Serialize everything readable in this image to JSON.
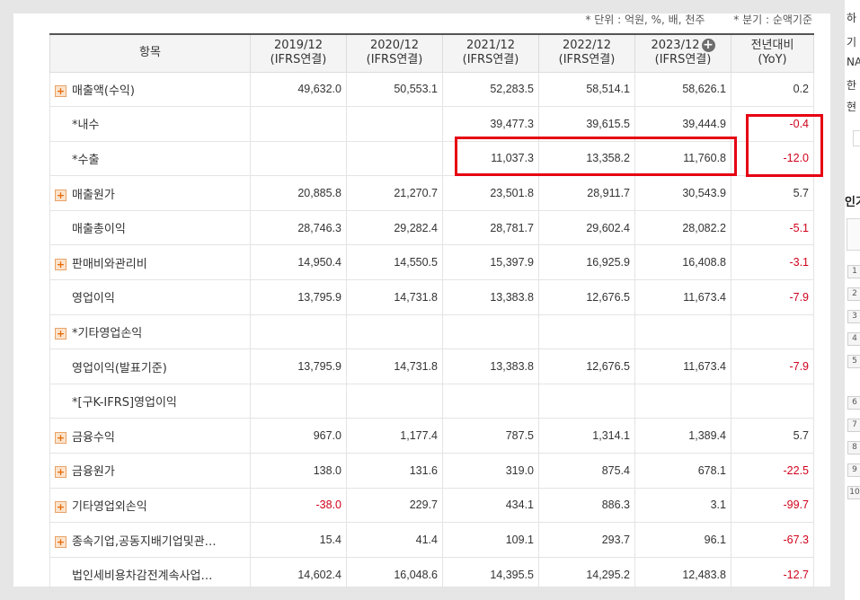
{
  "units": {
    "left": "* 단위 : 억원, %, 배, 천주",
    "right": "* 분기 : 순액기준"
  },
  "header": {
    "item": "항목",
    "cols": [
      {
        "year": "2019/12",
        "basis": "(IFRS연결)"
      },
      {
        "year": "2020/12",
        "basis": "(IFRS연결)"
      },
      {
        "year": "2021/12",
        "basis": "(IFRS연결)"
      },
      {
        "year": "2022/12",
        "basis": "(IFRS연결)"
      },
      {
        "year": "2023/12",
        "basis": "(IFRS연결)"
      }
    ],
    "yoy1": "전년대비",
    "yoy2": "(YoY)",
    "add_icon": "plus-circle-icon"
  },
  "rows": [
    {
      "label": "매출액(수익)",
      "expand": true,
      "values": [
        "49,632.0",
        "50,553.1",
        "52,283.5",
        "58,514.1",
        "58,626.1"
      ],
      "yoy": "0.2",
      "neg_yoy": false
    },
    {
      "label": "*내수",
      "expand": false,
      "values": [
        "",
        "",
        "39,477.3",
        "39,615.5",
        "39,444.9"
      ],
      "yoy": "-0.4",
      "neg_yoy": true
    },
    {
      "label": "*수출",
      "expand": false,
      "values": [
        "",
        "",
        "11,037.3",
        "13,358.2",
        "11,760.8"
      ],
      "yoy": "-12.0",
      "neg_yoy": true
    },
    {
      "label": "매출원가",
      "expand": true,
      "values": [
        "20,885.8",
        "21,270.7",
        "23,501.8",
        "28,911.7",
        "30,543.9"
      ],
      "yoy": "5.7",
      "neg_yoy": false
    },
    {
      "label": "매출총이익",
      "expand": false,
      "values": [
        "28,746.3",
        "29,282.4",
        "28,781.7",
        "29,602.4",
        "28,082.2"
      ],
      "yoy": "-5.1",
      "neg_yoy": true
    },
    {
      "label": "판매비와관리비",
      "expand": true,
      "values": [
        "14,950.4",
        "14,550.5",
        "15,397.9",
        "16,925.9",
        "16,408.8"
      ],
      "yoy": "-3.1",
      "neg_yoy": true
    },
    {
      "label": "영업이익",
      "expand": false,
      "values": [
        "13,795.9",
        "14,731.8",
        "13,383.8",
        "12,676.5",
        "11,673.4"
      ],
      "yoy": "-7.9",
      "neg_yoy": true
    },
    {
      "label": "*기타영업손익",
      "expand": true,
      "values": [
        "",
        "",
        "",
        "",
        ""
      ],
      "yoy": "",
      "neg_yoy": false
    },
    {
      "label": "영업이익(발표기준)",
      "expand": false,
      "values": [
        "13,795.9",
        "14,731.8",
        "13,383.8",
        "12,676.5",
        "11,673.4"
      ],
      "yoy": "-7.9",
      "neg_yoy": true
    },
    {
      "label": "*[구K-IFRS]영업이익",
      "expand": false,
      "values": [
        "",
        "",
        "",
        "",
        ""
      ],
      "yoy": "",
      "neg_yoy": false
    },
    {
      "label": "금융수익",
      "expand": true,
      "values": [
        "967.0",
        "1,177.4",
        "787.5",
        "1,314.1",
        "1,389.4"
      ],
      "yoy": "5.7",
      "neg_yoy": false
    },
    {
      "label": "금융원가",
      "expand": true,
      "values": [
        "138.0",
        "131.6",
        "319.0",
        "875.4",
        "678.1"
      ],
      "yoy": "-22.5",
      "neg_yoy": true
    },
    {
      "label": "기타영업외손익",
      "expand": true,
      "values": [
        "-38.0",
        "229.7",
        "434.1",
        "886.3",
        "3.1"
      ],
      "yoy": "-99.7",
      "neg_yoy": true,
      "neg_first": true
    },
    {
      "label": "종속기업,공동지배기업및관…",
      "expand": true,
      "values": [
        "15.4",
        "41.4",
        "109.1",
        "293.7",
        "96.1"
      ],
      "yoy": "-67.3",
      "neg_yoy": true
    },
    {
      "label": "법인세비용차감전계속사업…",
      "expand": false,
      "values": [
        "14,602.4",
        "16,048.6",
        "14,395.5",
        "14,295.2",
        "12,483.8"
      ],
      "yoy": "-12.7",
      "neg_yoy": true
    }
  ],
  "sidebar": {
    "text_lines": [
      "하",
      "기",
      "NA",
      "한",
      "현"
    ],
    "title": "인기",
    "ranks": [
      "1",
      "2",
      "3",
      "4",
      "5",
      "6",
      "7",
      "8",
      "9",
      "10"
    ]
  },
  "highlight_color": "#e60012"
}
